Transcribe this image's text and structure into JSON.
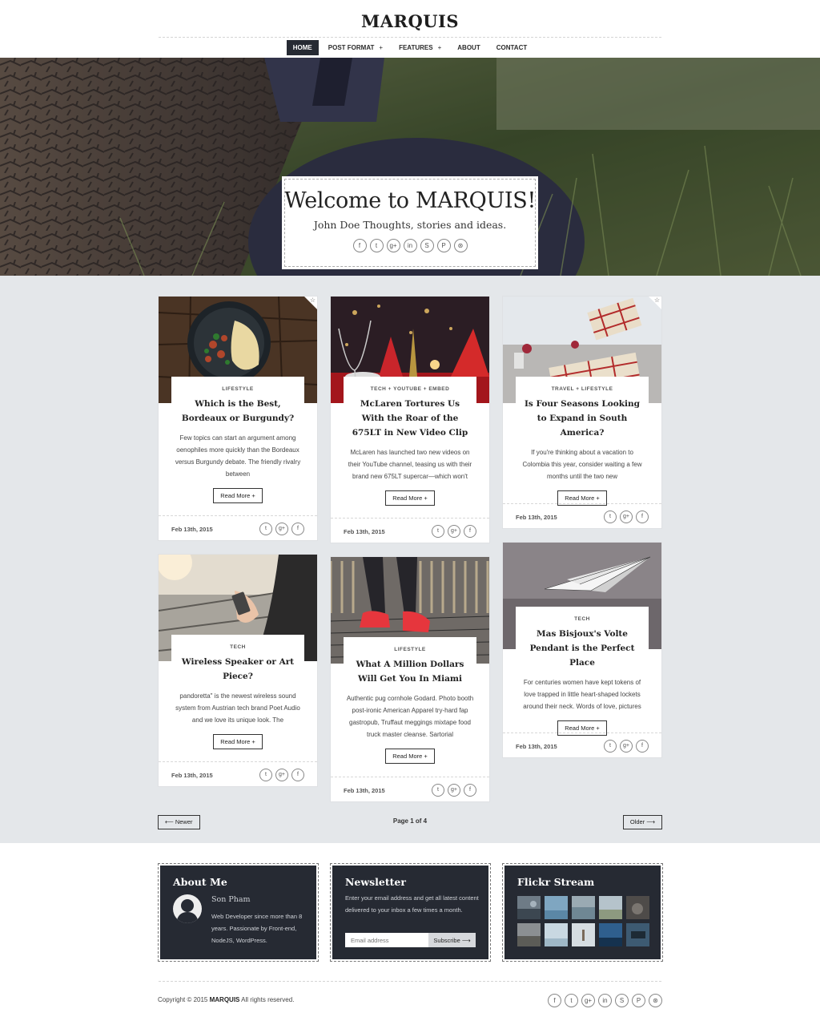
{
  "site": {
    "logo": "MARQUIS"
  },
  "nav": [
    {
      "label": "HOME",
      "active": true,
      "submenu": false
    },
    {
      "label": "POST FORMAT",
      "active": false,
      "submenu": true
    },
    {
      "label": "FEATURES",
      "active": false,
      "submenu": true
    },
    {
      "label": "ABOUT",
      "active": false,
      "submenu": false
    },
    {
      "label": "CONTACT",
      "active": false,
      "submenu": false
    }
  ],
  "nav_plus": "+",
  "hero": {
    "title": "Welcome to MARQUIS!",
    "subtitle": "John Doe Thoughts, stories and ideas.",
    "social": [
      "facebook-icon",
      "twitter-icon",
      "google-plus-icon",
      "linkedin-icon",
      "skype-icon",
      "pinterest-icon",
      "dribbble-icon"
    ]
  },
  "social_glyphs": {
    "f": "f",
    "t": "t",
    "g": "g+",
    "in": "in",
    "s": "S",
    "p": "P",
    "d": "⊛"
  },
  "posts": [
    {
      "category": "LIFESTYLE",
      "title": "Which is the Best, Bordeaux or Burgundy?",
      "excerpt": "Few topics can start an argument among oenophiles more quickly than the Bordeaux versus Burgundy debate. The friendly rivalry between",
      "read_more": "Read More +",
      "date": "Feb 13th, 2015",
      "sticky": true
    },
    {
      "category": "TECH  +  YOUTUBE  +  EMBED",
      "title": "McLaren Tortures Us With the Roar of the 675LT in New Video Clip",
      "excerpt": "McLaren has launched two new videos on their YouTube channel, teasing us with their brand new 675LT supercar—which won't",
      "read_more": "Read More +",
      "date": "Feb 13th, 2015",
      "sticky": false
    },
    {
      "category": "TRAVEL  +  LIFESTYLE",
      "title": "Is Four Seasons Looking to Expand in South America?",
      "excerpt": "If you're thinking about a vacation to Colombia this year, consider waiting a few months until the two new",
      "read_more": "Read More +",
      "date": "Feb 13th, 2015",
      "sticky": true
    },
    {
      "category": "TECH",
      "title": "Wireless Speaker or Art Piece?",
      "excerpt": "pandoretta\" is the newest wireless sound system from Austrian tech brand Poet Audio and we love its unique look. The",
      "read_more": "Read More +",
      "date": "Feb 13th, 2015",
      "sticky": false
    },
    {
      "category": "LIFESTYLE",
      "title": "What A Million Dollars Will Get You In Miami",
      "excerpt": "Authentic pug cornhole Godard. Photo booth post-ironic American Apparel try-hard fap gastropub, Truffaut meggings mixtape food truck master cleanse. Sartorial",
      "read_more": "Read More +",
      "date": "Feb 13th, 2015",
      "sticky": false
    },
    {
      "category": "TECH",
      "title": "Mas Bisjoux's Volte Pendant is the Perfect Place",
      "excerpt": "For centuries women have kept tokens of love trapped in little heart-shaped lockets around their neck. Words of love, pictures",
      "read_more": "Read More +",
      "date": "Feb 13th, 2015",
      "sticky": false
    }
  ],
  "share_icons": [
    "twitter-icon",
    "google-plus-icon",
    "facebook-icon"
  ],
  "pagination": {
    "newer": "⟵ Newer",
    "older": "Older ⟶",
    "info": "Page 1 of 4"
  },
  "about": {
    "title": "About Me",
    "name": "Son Pham",
    "bio": "Web Developer since more than 8 years. Passionate by Front-end, NodeJS, WordPress."
  },
  "newsletter": {
    "title": "Newsletter",
    "text": "Enter your email address and get all latest content delivered to your inbox a few times a month.",
    "placeholder": "Email address",
    "button": "Subscribe ⟶"
  },
  "flickr": {
    "title": "Flickr Stream"
  },
  "footer": {
    "copyright_pre": "Copyright © 2015 ",
    "brand": "MARQUIS",
    "copyright_post": " All rights reserved."
  },
  "colors": {
    "dark": "#262a33",
    "content_bg": "#e4e7ea"
  }
}
